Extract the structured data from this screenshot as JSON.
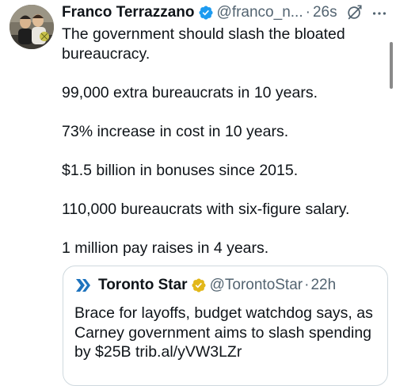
{
  "tweet": {
    "author": {
      "name": "Franco Terrazzano",
      "handle": "@franco_n...",
      "time": "26s",
      "separator": "·"
    },
    "paragraphs": [
      "The government should slash the bloated bureaucracy.",
      "99,000 extra bureaucrats in 10 years.",
      "73% increase in cost in 10 years.",
      "$1.5 billion in bonuses since 2015.",
      "110,000 bureaucrats with six-figure salary.",
      "1 million pay raises in 4 years."
    ]
  },
  "quote": {
    "author": {
      "name": "Toronto Star",
      "handle": "@TorontoStar",
      "time": "22h",
      "separator": "·"
    },
    "text": "Brace for layoffs, budget watchdog says, as Carney government aims to slash spending by $25B trib.al/yVW3LZr"
  },
  "icons": {
    "verified": "verified-badge-icon",
    "gold_badge": "gold-verified-badge-icon",
    "grok": "grok-icon",
    "more": "more-options-icon",
    "logo": "toronto-star-logo"
  },
  "colors": {
    "verified_blue": "#1d9bf0",
    "gold": "#e2b719",
    "secondary_text": "#536471",
    "primary_text": "#0f1419",
    "border": "#cfd9de",
    "star_blue": "#1e73be"
  }
}
